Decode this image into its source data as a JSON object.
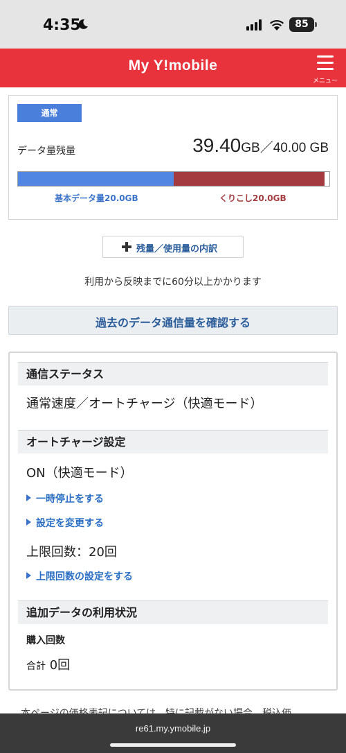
{
  "status_bar": {
    "time": "4:35",
    "battery": "85"
  },
  "header": {
    "title": "My Y!mobile",
    "menu_label": "メニュー"
  },
  "data_card": {
    "mode_badge": "通常",
    "remaining_label": "データ量残量",
    "remaining_amount": "39.40",
    "remaining_unit": "GB",
    "total_text": "／40.00 GB",
    "basic_label": "基本データ量20.0GB",
    "carryover_label": "くりこし20.0GB",
    "bar": {
      "basic_fraction": 0.5,
      "carryover_fraction": 0.485,
      "used_fraction": 0.015
    },
    "colors": {
      "basic": "#5186e3",
      "carryover": "#a43b3f"
    }
  },
  "breakdown_button": {
    "label": "残量／使用量の内訳",
    "icon": "plus-icon"
  },
  "notice": "利用から反映までに60分以上かかります",
  "history_button": {
    "label": "過去のデータ通信量を確認する"
  },
  "status": {
    "comm_status_title": "通信ステータス",
    "comm_status_value": "通常速度／オートチャージ（快適モード）",
    "autocharge_title": "オートチャージ設定",
    "autocharge_value": "ON（快適モード）",
    "pause_link": "一時停止をする",
    "change_link": "設定を変更する",
    "limit_value": "上限回数：20回",
    "limit_link": "上限回数の設定をする",
    "extra_data_title": "追加データの利用状況",
    "purchase_label": "購入回数",
    "purchase_prefix": "合計",
    "purchase_count": "0回"
  },
  "footnote": "本ページの価格表記については、特に記載がない場合、税込価",
  "browser": {
    "url": "re61.my.ymobile.jp"
  }
}
